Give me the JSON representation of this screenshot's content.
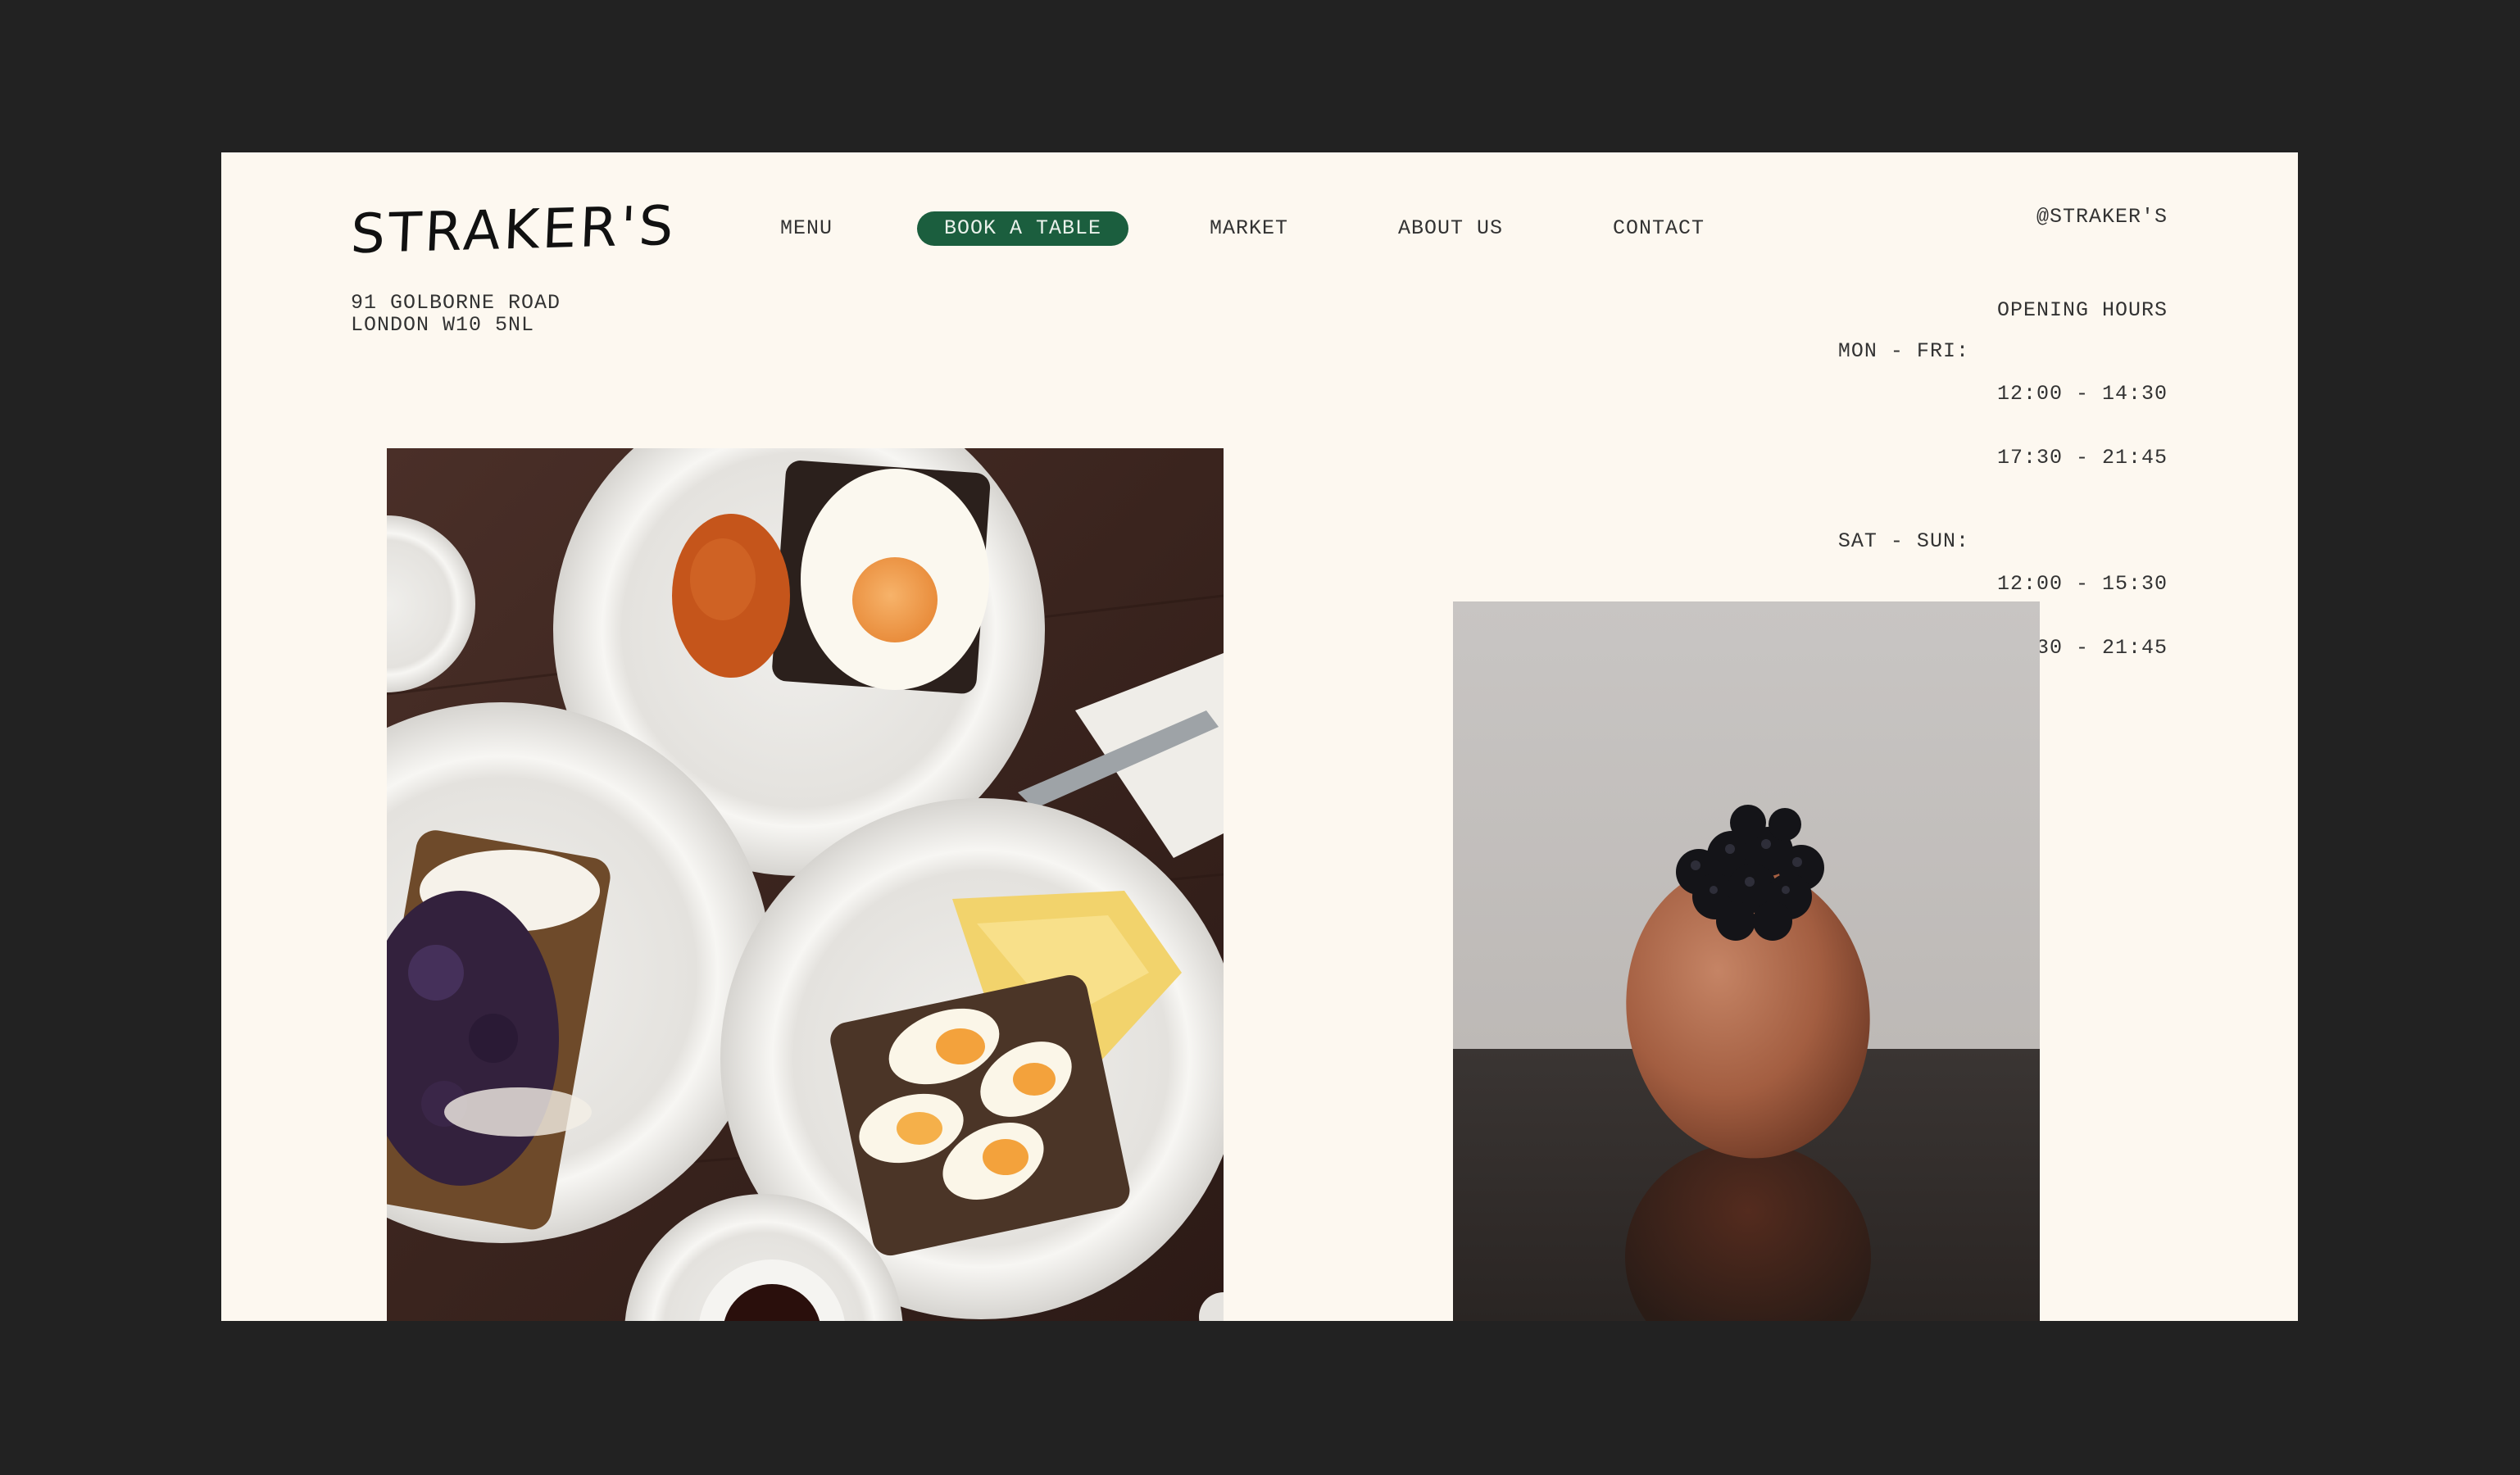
{
  "brand": {
    "logo": "STRAKER'S"
  },
  "nav": {
    "menu": "MENU",
    "book": "BOOK A TABLE",
    "market": "MARKET",
    "about": "ABOUT US",
    "contact": "CONTACT"
  },
  "social": {
    "handle": "@STRAKER'S"
  },
  "address": {
    "line1": "91 GOLBORNE ROAD",
    "line2": "LONDON W10 5NL"
  },
  "hours": {
    "title": "OPENING HOURS",
    "weekday": {
      "days": "MON - FRI:",
      "slot1": "12:00 - 14:30",
      "slot2": "17:30 - 21:45"
    },
    "weekend": {
      "days": "SAT - SUN:",
      "slot1": "12:00 - 15:30",
      "slot2": "17:30 - 21:45"
    }
  },
  "colors": {
    "page_bg": "#fdf8f0",
    "frame_bg": "#222222",
    "accent": "#1b5e3e"
  }
}
